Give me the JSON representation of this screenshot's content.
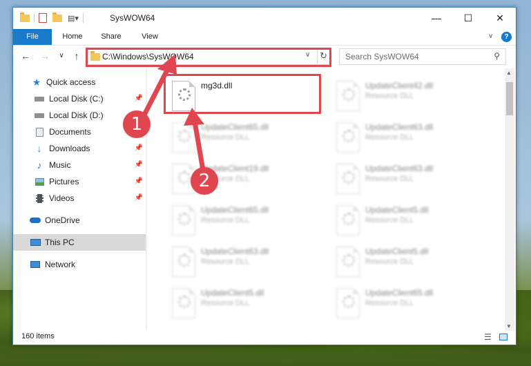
{
  "window": {
    "title": "SysWOW64"
  },
  "ribbon": {
    "tabs": [
      "File",
      "Home",
      "Share",
      "View"
    ],
    "help_label": "?"
  },
  "nav": {
    "address": "C:\\Windows\\SysWOW64",
    "search_placeholder": "Search SysWOW64"
  },
  "sidebar": {
    "items": [
      {
        "label": "Quick access",
        "icon": "star-icon"
      },
      {
        "label": "Local Disk (C:)",
        "icon": "drive-icon"
      },
      {
        "label": "Local Disk (D:)",
        "icon": "drive-icon"
      },
      {
        "label": "Documents",
        "icon": "documents-icon"
      },
      {
        "label": "Downloads",
        "icon": "download-icon"
      },
      {
        "label": "Music",
        "icon": "music-icon"
      },
      {
        "label": "Pictures",
        "icon": "pictures-icon"
      },
      {
        "label": "Videos",
        "icon": "videos-icon"
      },
      {
        "label": "OneDrive",
        "icon": "cloud-icon"
      },
      {
        "label": "This PC",
        "icon": "pc-icon"
      },
      {
        "label": "Network",
        "icon": "network-icon"
      }
    ]
  },
  "files": {
    "highlighted": {
      "name": "mg3d.dll",
      "type": ""
    },
    "left_column": [
      {
        "name": "UpdateClient65.dll",
        "type": "Resource DLL"
      },
      {
        "name": "UpdateClient19.dll",
        "type": "Resource DLL"
      },
      {
        "name": "UpdateClient65.dll",
        "type": "Resource DLL"
      },
      {
        "name": "UpdateClient63.dll",
        "type": "Resource DLL"
      },
      {
        "name": "UpdateClient5.dll",
        "type": "Resource DLL"
      }
    ],
    "right_column": [
      {
        "name": "UpdateClient42.dll",
        "type": "Resource DLL"
      },
      {
        "name": "UpdateClient63.dll",
        "type": "Resource DLL"
      },
      {
        "name": "UpdateClient63.dll",
        "type": "Resource DLL"
      },
      {
        "name": "UpdateClient5.dll",
        "type": "Resource DLL"
      },
      {
        "name": "UpdateClient5.dll",
        "type": "Resource DLL"
      },
      {
        "name": "UpdateClient65.dll",
        "type": "Resource DLL"
      }
    ]
  },
  "status": {
    "item_count": "160 items"
  },
  "annotations": {
    "step1": "1",
    "step2": "2"
  },
  "colors": {
    "accent": "#1979ca",
    "highlight": "#e0464f"
  }
}
